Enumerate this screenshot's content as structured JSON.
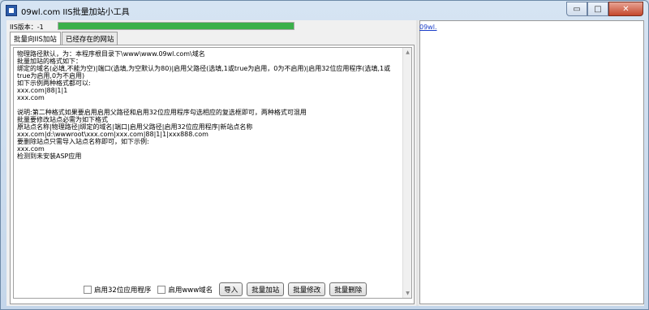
{
  "window": {
    "title": "09wl.com IIS批量加站小工具",
    "minimize_glyph": "▭",
    "maximize_glyph": "□",
    "close_glyph": "✕"
  },
  "status": {
    "iis_version": "IIS版本：-1",
    "progress": 1.0,
    "progress_color": "#3bb04a"
  },
  "tabs": [
    {
      "label": "批量向IIS加站",
      "active": true
    },
    {
      "label": "已经存在的网站",
      "active": false
    }
  ],
  "main": {
    "text": "物理路径默认，为：本程序根目录下\\www\\www.09wl.com\\域名\n批量加站的格式如下：\n绑定的域名(必填,不能为空)|端口(选填,为空默认为80)|启用父路径(选填,1或true为启用，0为不启用)|启用32位应用程序(选填,1或true为启用,0为不启用)\n如下示例两种格式都可以:\nxxx.com|88|1|1\nxxx.com\n\n说明:第二种格式如果要启用启用父路径和启用32位应用程序勾选相应的复选框即可，两种格式可混用\n批量要修改站点必需为如下格式\n原站点名称|物理路径|绑定的域名|端口|启用父路径|启用32位应用程序|新站点名称\nxxx.com|d:\\wwwroot\\xxx.com|xxx.com|88|1|1|xxx888.com\n要删除站点只需导入站点名称即可，如下示例:\nxxx.com\n检测到未安装ASP应用"
  },
  "controls": {
    "enable32_label": "启用32位应用程序",
    "enable_www_label": "启用www域名",
    "import_label": "导入",
    "batch_add_label": "批量加站",
    "batch_edit_label": "批量修改",
    "batch_delete_label": "批量删除"
  },
  "right_pane": {
    "link_text": "09wl."
  },
  "scroll": {
    "up_glyph": "▲",
    "down_glyph": "▼"
  }
}
